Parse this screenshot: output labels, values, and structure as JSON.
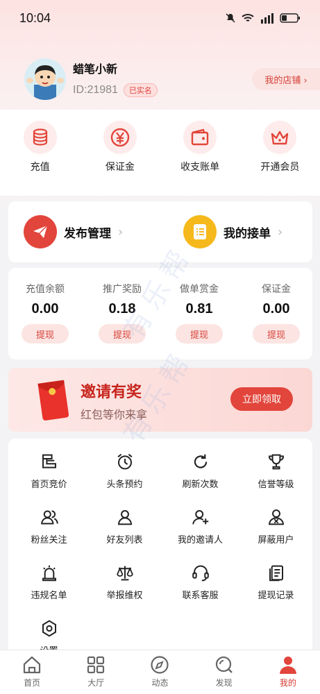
{
  "status_bar": {
    "time": "10:04"
  },
  "profile": {
    "nickname": "蜡笔小新",
    "user_id": "ID:21981",
    "verified": "已实名",
    "store_button": "我的店铺 ›"
  },
  "quick_actions": [
    {
      "label": "充值",
      "icon": "coins-icon"
    },
    {
      "label": "保证金",
      "icon": "yen-icon"
    },
    {
      "label": "收支账单",
      "icon": "wallet-icon"
    },
    {
      "label": "开通会员",
      "icon": "crown-icon"
    }
  ],
  "publish": {
    "publish_label": "发布管理",
    "orders_label": "我的接单",
    "arrow": "›"
  },
  "balances": [
    {
      "label": "充值余额",
      "value": "0.00",
      "button": "提现"
    },
    {
      "label": "推广奖励",
      "value": "0.18",
      "button": "提现"
    },
    {
      "label": "做单赏金",
      "value": "0.81",
      "button": "提现"
    },
    {
      "label": "保证金",
      "value": "0.00",
      "button": "提现"
    }
  ],
  "invite": {
    "title": "邀请有奖",
    "subtitle": "红包等你来拿",
    "button": "立即领取"
  },
  "menu": [
    {
      "label": "首页竞价",
      "icon": "bid-icon"
    },
    {
      "label": "头条预约",
      "icon": "alarm-clock-icon"
    },
    {
      "label": "刷新次数",
      "icon": "refresh-icon"
    },
    {
      "label": "信誉等级",
      "icon": "trophy-icon"
    },
    {
      "label": "粉丝关注",
      "icon": "fans-icon"
    },
    {
      "label": "好友列表",
      "icon": "user-icon"
    },
    {
      "label": "我的邀请人",
      "icon": "user-add-icon"
    },
    {
      "label": "屏蔽用户",
      "icon": "user-block-icon"
    },
    {
      "label": "违规名单",
      "icon": "alarm-light-icon"
    },
    {
      "label": "举报维权",
      "icon": "scale-icon"
    },
    {
      "label": "联系客服",
      "icon": "headset-icon"
    },
    {
      "label": "提现记录",
      "icon": "records-icon"
    },
    {
      "label": "设置",
      "icon": "settings-icon"
    }
  ],
  "tabs": [
    {
      "label": "首页",
      "icon": "home-icon",
      "active": false
    },
    {
      "label": "大厅",
      "icon": "grid-icon",
      "active": false
    },
    {
      "label": "动态",
      "icon": "compass-icon",
      "active": false
    },
    {
      "label": "发现",
      "icon": "search-icon",
      "active": false
    },
    {
      "label": "我的",
      "icon": "profile-icon",
      "active": true
    }
  ],
  "watermark": "有乐帮",
  "colors": {
    "accent": "#e2453b",
    "accent_light": "#fbe4e2",
    "orders_icon": "#f6b91c"
  }
}
